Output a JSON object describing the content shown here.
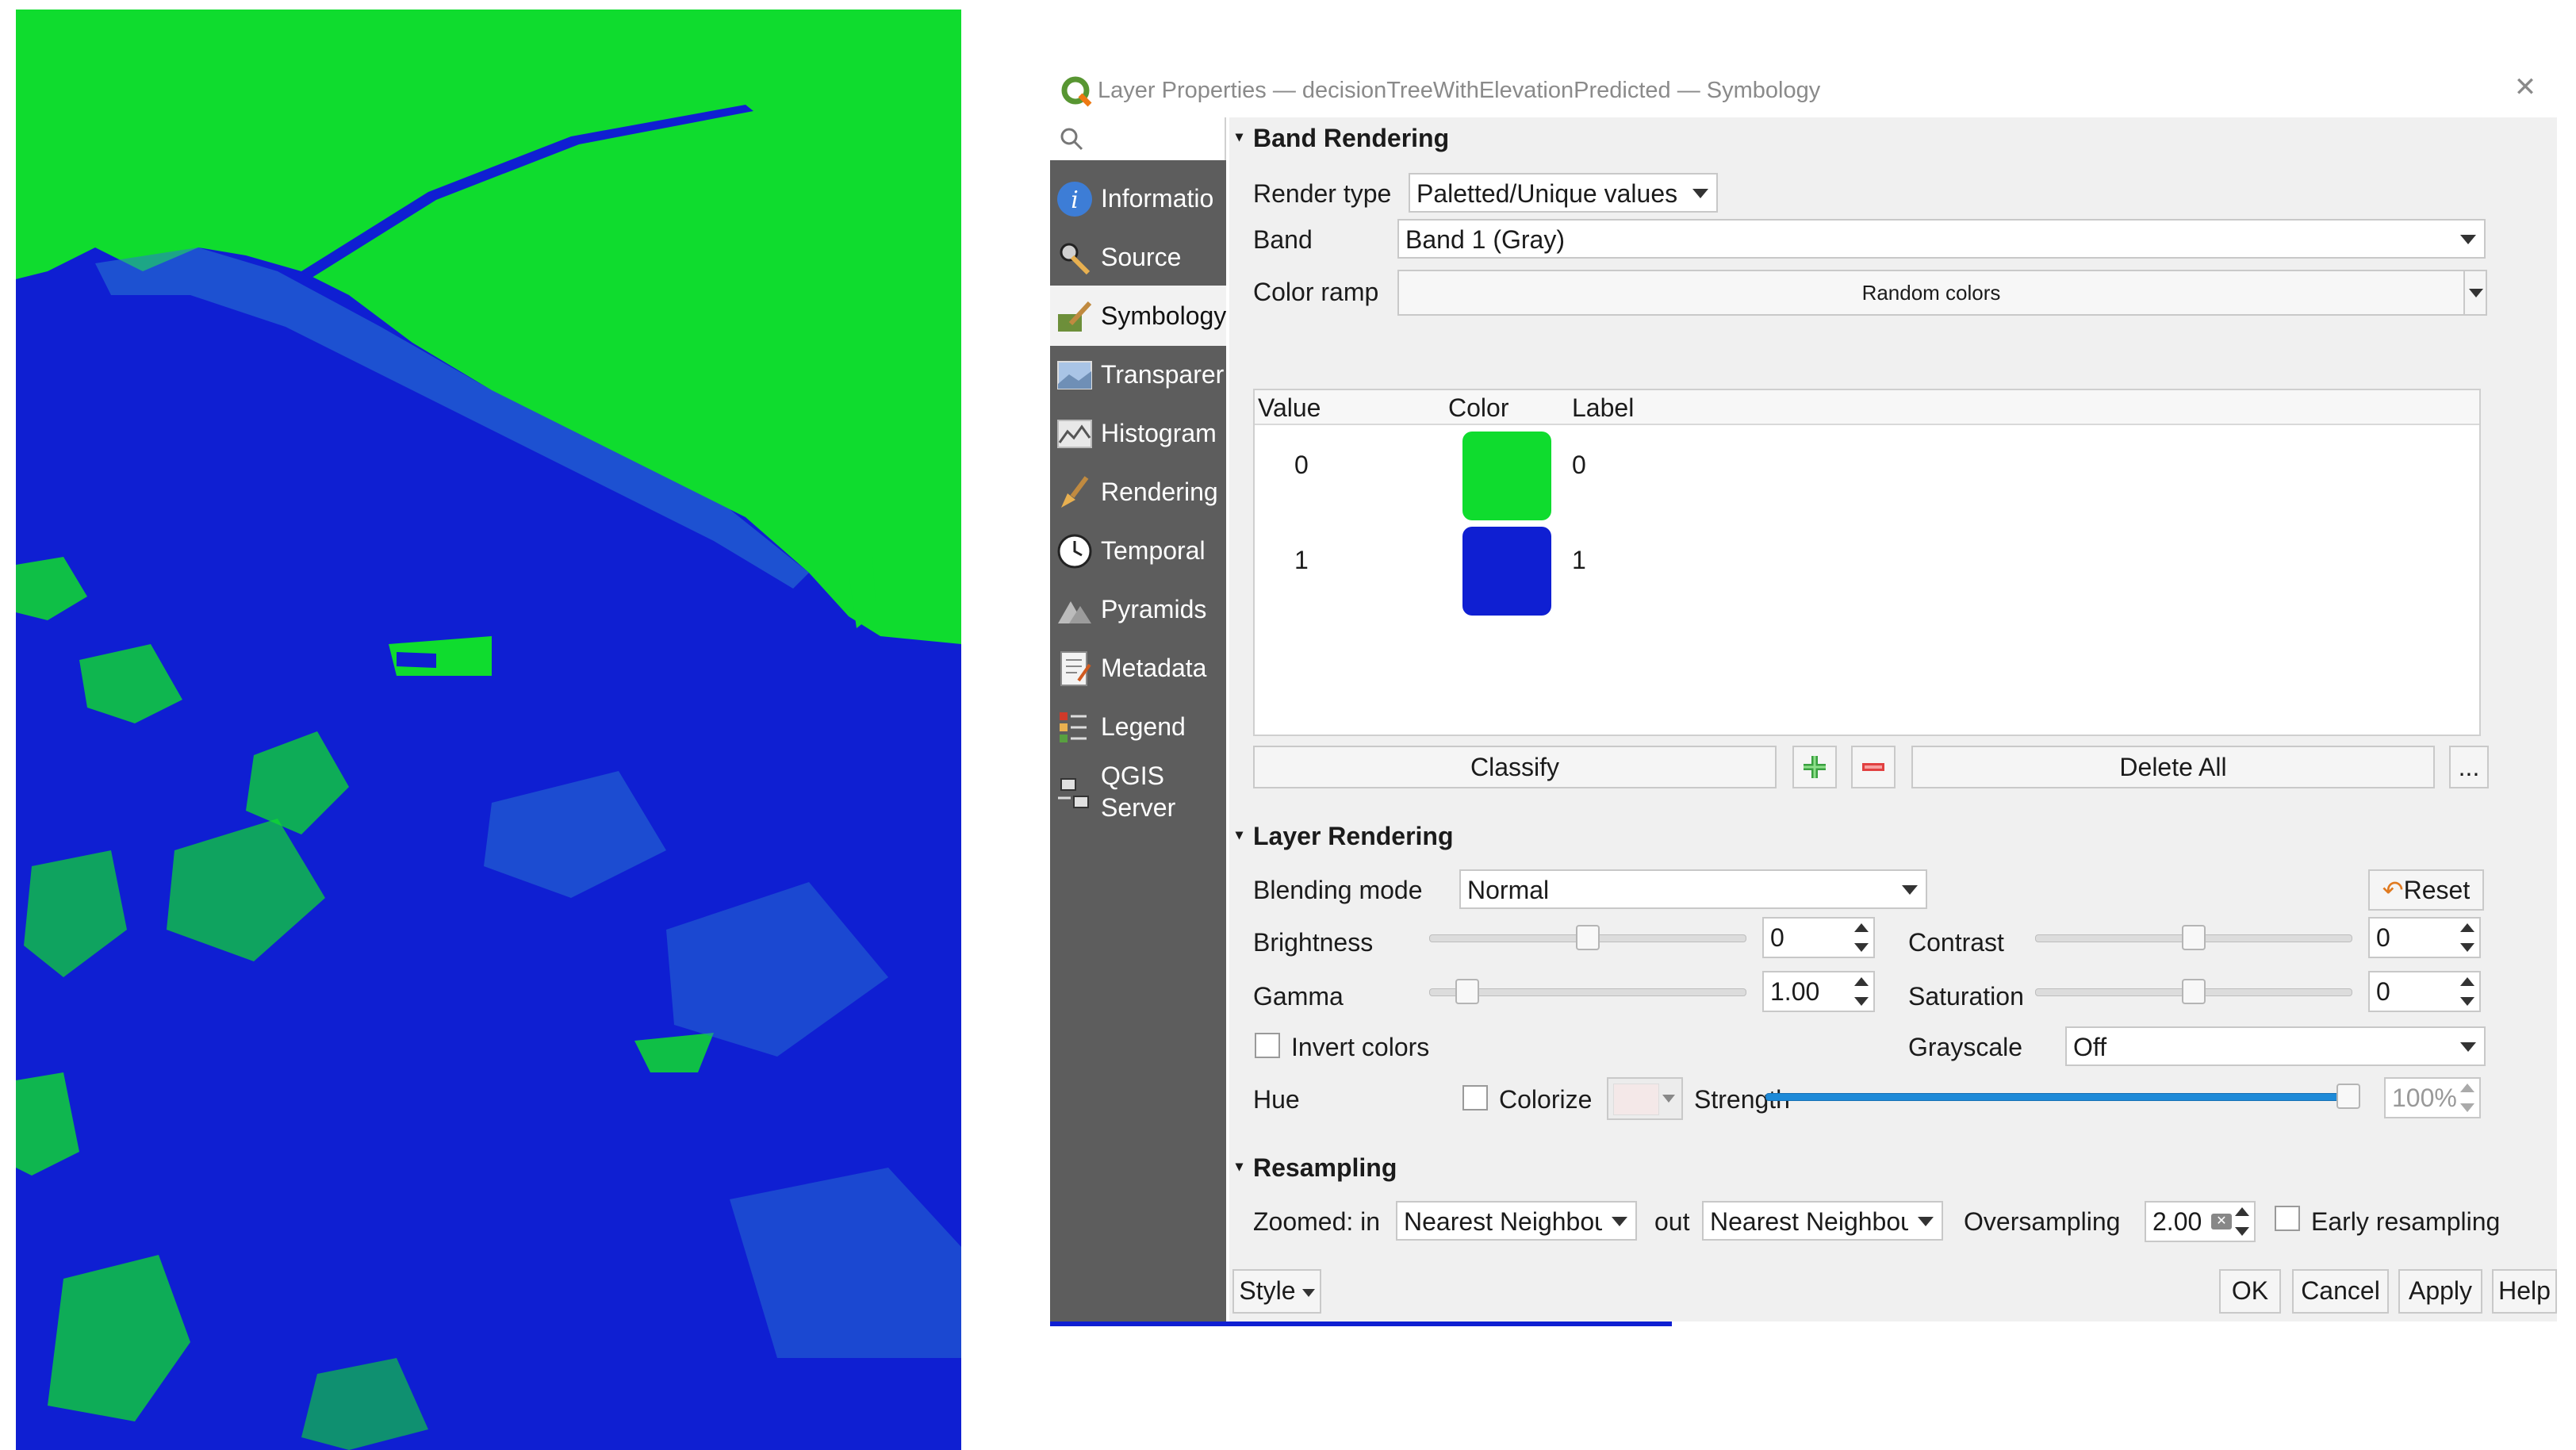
{
  "colors": {
    "class0_green": "#0fdc2e",
    "class1_blue": "#0f1fd2",
    "sidebar_bg": "#5d5d5d",
    "strength_bar": "#1e8ad8"
  },
  "dialog": {
    "title": "Layer Properties — decisionTreeWithElevationPredicted — Symbology",
    "close_icon": "close-icon"
  },
  "sidebar": {
    "search_icon": "search-icon",
    "items": [
      {
        "label": "Informatio",
        "icon": "info-icon"
      },
      {
        "label": "Source",
        "icon": "source-icon"
      },
      {
        "label": "Symbology",
        "icon": "symbology-icon"
      },
      {
        "label": "Transparer",
        "icon": "transparency-icon"
      },
      {
        "label": "Histogram",
        "icon": "histogram-icon"
      },
      {
        "label": "Rendering",
        "icon": "rendering-brush-icon"
      },
      {
        "label": "Temporal",
        "icon": "clock-icon"
      },
      {
        "label": "Pyramids",
        "icon": "pyramids-icon"
      },
      {
        "label": "Metadata",
        "icon": "metadata-icon"
      },
      {
        "label": "Legend",
        "icon": "legend-icon"
      },
      {
        "label": "QGIS Server",
        "icon": "server-icon"
      }
    ],
    "active_index": 2
  },
  "band_rendering": {
    "header": "Band Rendering",
    "render_type_label": "Render type",
    "render_type_value": "Paletted/Unique values",
    "band_label": "Band",
    "band_value": "Band 1 (Gray)",
    "color_ramp_label": "Color ramp",
    "color_ramp_value": "Random colors",
    "table": {
      "headers": [
        "Value",
        "Color",
        "Label"
      ],
      "rows": [
        {
          "value": "0",
          "color": "#0fdc2e",
          "label": "0"
        },
        {
          "value": "1",
          "color": "#0f1fd2",
          "label": "1"
        }
      ]
    },
    "classify_label": "Classify",
    "delete_all_label": "Delete All",
    "more_label": "..."
  },
  "layer_rendering": {
    "header": "Layer Rendering",
    "blending_label": "Blending mode",
    "blending_value": "Normal",
    "reset_label": "Reset",
    "brightness_label": "Brightness",
    "brightness_value": "0",
    "contrast_label": "Contrast",
    "contrast_value": "0",
    "gamma_label": "Gamma",
    "gamma_value": "1.00",
    "saturation_label": "Saturation",
    "saturation_value": "0",
    "invert_label": "Invert colors",
    "grayscale_label": "Grayscale",
    "grayscale_value": "Off",
    "hue_label": "Hue",
    "colorize_label": "Colorize",
    "strength_label": "Strength",
    "strength_value": "100%",
    "strength_fraction": 1.0
  },
  "resampling": {
    "header": "Resampling",
    "zoomed_in_label": "Zoomed: in",
    "zoomed_in_value": "Nearest Neighbour",
    "zoomed_out_label": "out",
    "zoomed_out_value": "Nearest Neighbour",
    "oversampling_label": "Oversampling",
    "oversampling_value": "2.00",
    "early_label": "Early resampling"
  },
  "footer": {
    "style_label": "Style",
    "ok_label": "OK",
    "cancel_label": "Cancel",
    "apply_label": "Apply",
    "help_label": "Help"
  }
}
